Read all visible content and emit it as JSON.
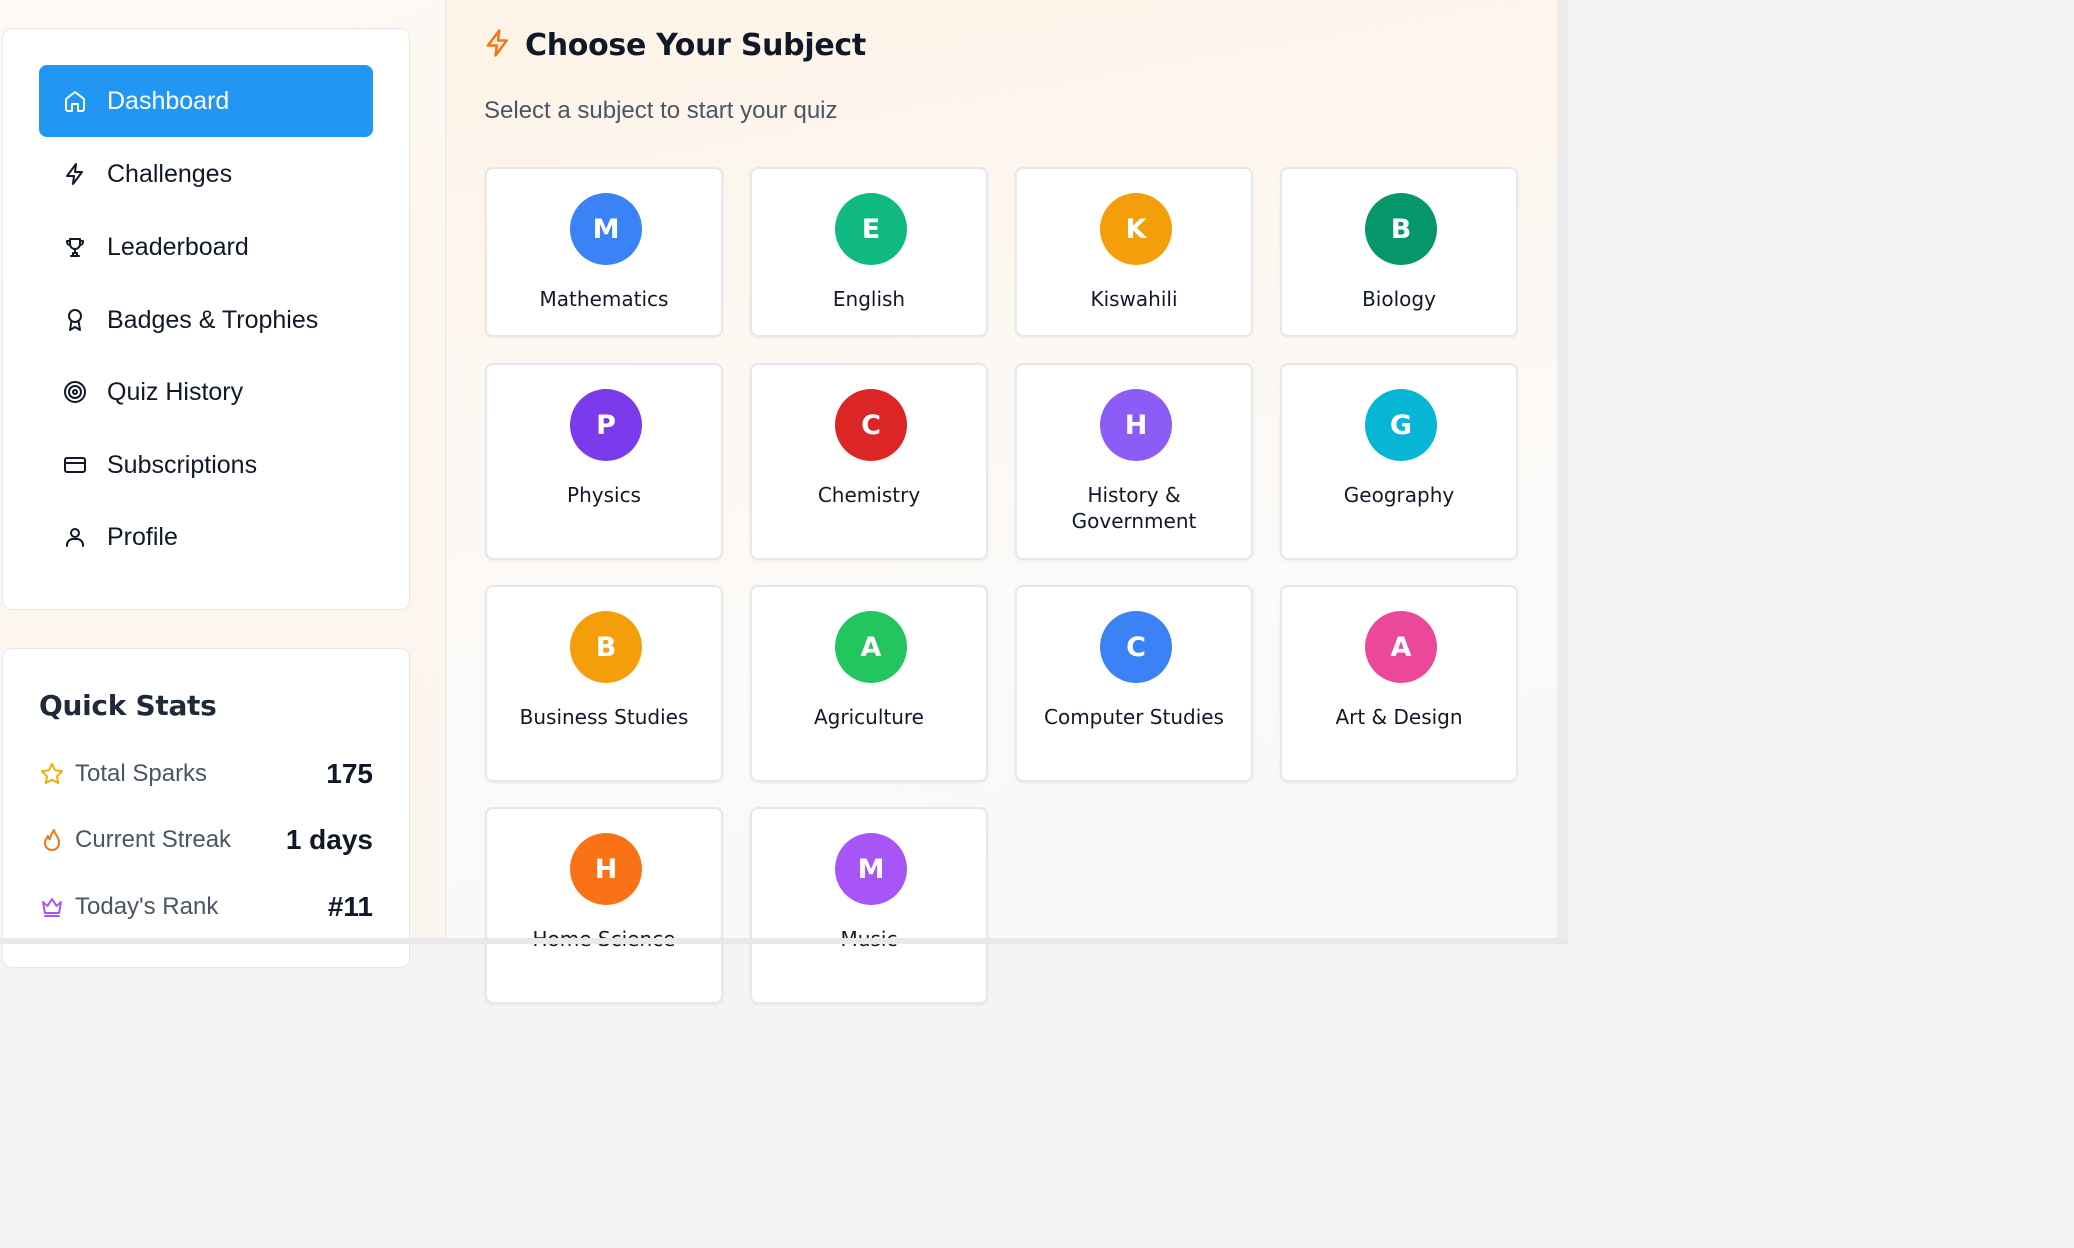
{
  "sidebar": {
    "items": [
      {
        "label": "Dashboard",
        "icon": "home-icon",
        "active": true
      },
      {
        "label": "Challenges",
        "icon": "lightning-icon",
        "active": false
      },
      {
        "label": "Leaderboard",
        "icon": "trophy-icon",
        "active": false
      },
      {
        "label": "Badges & Trophies",
        "icon": "award-icon",
        "active": false
      },
      {
        "label": "Quiz History",
        "icon": "target-icon",
        "active": false
      },
      {
        "label": "Subscriptions",
        "icon": "credit-card-icon",
        "active": false
      },
      {
        "label": "Profile",
        "icon": "user-icon",
        "active": false
      }
    ]
  },
  "quick_stats": {
    "title": "Quick Stats",
    "rows": [
      {
        "label": "Total Sparks",
        "value": "175",
        "icon": "star-icon",
        "color": "#eab308"
      },
      {
        "label": "Current Streak",
        "value": "1 days",
        "icon": "flame-icon",
        "color": "#f97316"
      },
      {
        "label": "Today's Rank",
        "value": "#11",
        "icon": "crown-icon",
        "color": "#a855f7"
      }
    ]
  },
  "main": {
    "title": "Choose Your Subject",
    "subtitle": "Select a subject to start your quiz",
    "accent_color": "#f97316",
    "subjects": [
      {
        "letter": "M",
        "name": "Mathematics",
        "color": "#3b82f6"
      },
      {
        "letter": "E",
        "name": "English",
        "color": "#10b981"
      },
      {
        "letter": "K",
        "name": "Kiswahili",
        "color": "#f59e0b"
      },
      {
        "letter": "B",
        "name": "Biology",
        "color": "#059669"
      },
      {
        "letter": "P",
        "name": "Physics",
        "color": "#7c3aed"
      },
      {
        "letter": "C",
        "name": "Chemistry",
        "color": "#dc2626"
      },
      {
        "letter": "H",
        "name": "History & Government",
        "color": "#8b5cf6"
      },
      {
        "letter": "G",
        "name": "Geography",
        "color": "#06b6d4"
      },
      {
        "letter": "B",
        "name": "Business Studies",
        "color": "#f59e0b"
      },
      {
        "letter": "A",
        "name": "Agriculture",
        "color": "#22c55e"
      },
      {
        "letter": "C",
        "name": "Computer Studies",
        "color": "#3b82f6"
      },
      {
        "letter": "A",
        "name": "Art & Design",
        "color": "#ec4899"
      },
      {
        "letter": "H",
        "name": "Home Science",
        "color": "#f97316"
      },
      {
        "letter": "M",
        "name": "Music",
        "color": "#a855f7"
      }
    ]
  }
}
